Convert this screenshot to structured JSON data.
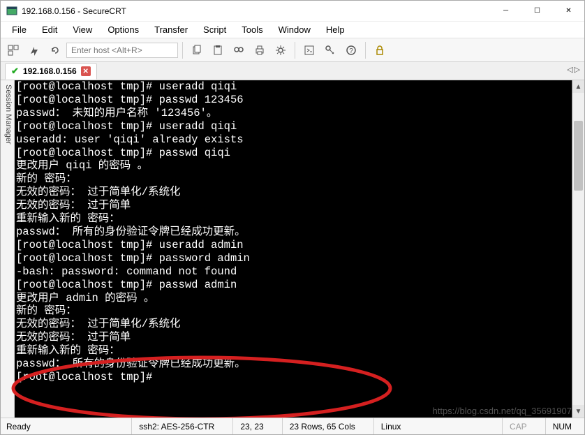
{
  "window": {
    "title": "192.168.0.156 - SecureCRT"
  },
  "menu": {
    "file": "File",
    "edit": "Edit",
    "view": "View",
    "options": "Options",
    "transfer": "Transfer",
    "script": "Script",
    "tools": "Tools",
    "window": "Window",
    "help": "Help"
  },
  "toolbar": {
    "host_placeholder": "Enter host <Alt+R>"
  },
  "tab": {
    "label": "192.168.0.156",
    "nav_left": "◁",
    "nav_right": "▷"
  },
  "side_panel": {
    "label": "Session Manager"
  },
  "terminal": {
    "lines": [
      "[root@localhost tmp]# useradd qiqi",
      "[root@localhost tmp]# passwd 123456",
      "passwd： 未知的用户名称 '123456'。",
      "[root@localhost tmp]# useradd qiqi",
      "useradd: user 'qiqi' already exists",
      "[root@localhost tmp]# passwd qiqi",
      "更改用户 qiqi 的密码 。",
      "新的 密码：",
      "无效的密码： 过于简单化/系统化",
      "无效的密码： 过于简单",
      "重新输入新的 密码：",
      "passwd： 所有的身份验证令牌已经成功更新。",
      "[root@localhost tmp]# useradd admin",
      "[root@localhost tmp]# password admin",
      "-bash: password: command not found",
      "[root@localhost tmp]# passwd admin",
      "更改用户 admin 的密码 。",
      "新的 密码：",
      "无效的密码： 过于简单化/系统化",
      "无效的密码： 过于简单",
      "重新输入新的 密码：",
      "passwd： 所有的身份验证令牌已经成功更新。",
      "[root@localhost tmp]# "
    ]
  },
  "status": {
    "ready": "Ready",
    "cipher": "ssh2: AES-256-CTR",
    "cursor": "23,  23",
    "dims": "23 Rows, 65 Cols",
    "os": "Linux",
    "cap": "CAP",
    "num": "NUM"
  },
  "watermark": "https://blog.csdn.net/qq_35691907"
}
